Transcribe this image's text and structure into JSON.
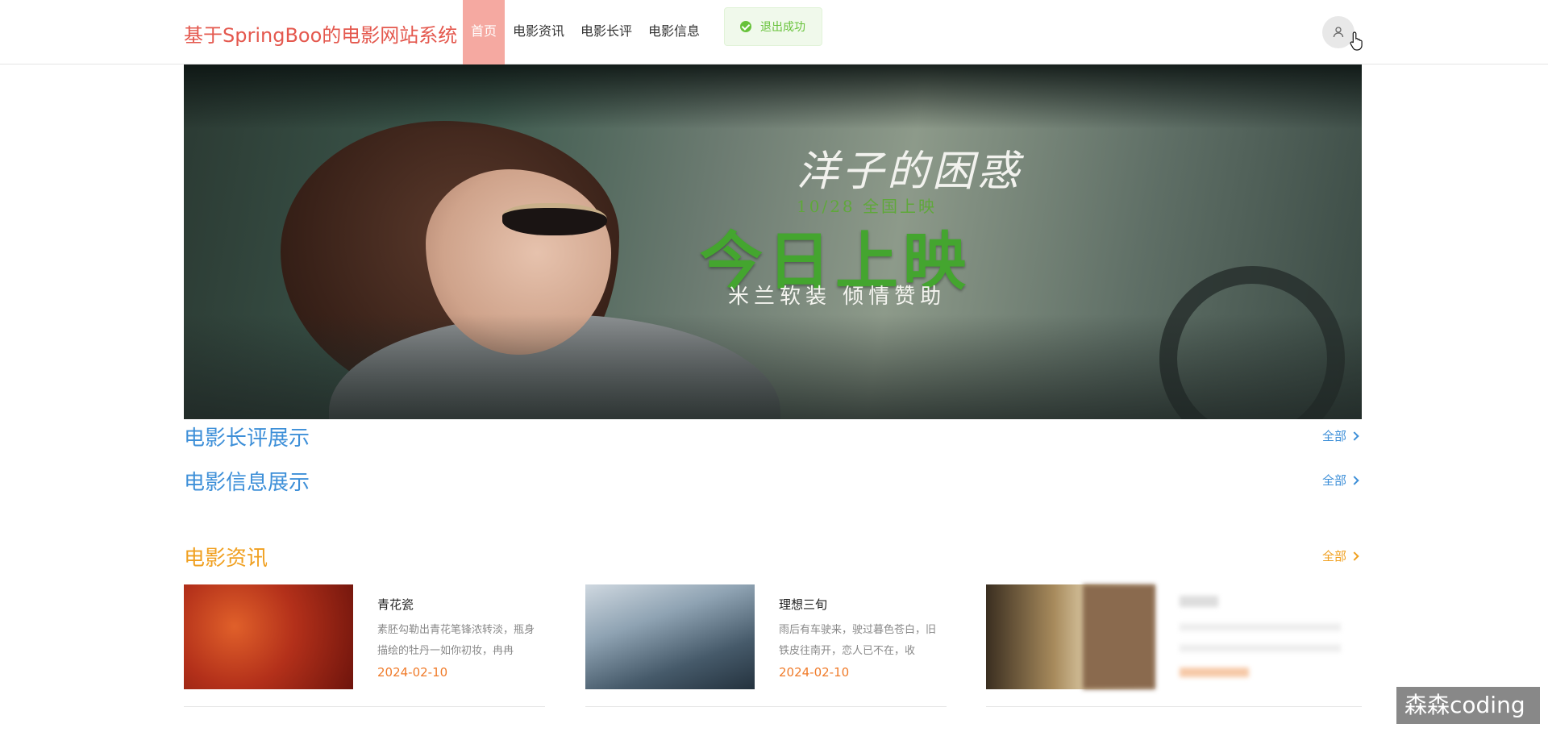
{
  "header": {
    "brand": "基于SpringBoo的电影网站系统",
    "nav": [
      "首页",
      "电影资讯",
      "电影长评",
      "电影信息"
    ],
    "active_nav": "首页"
  },
  "toast": {
    "message": "退出成功"
  },
  "banner": {
    "title": "洋子的困惑",
    "date_line": "10/28 全国上映",
    "headline": "今日上映",
    "sponsor": "米兰软装 倾情赞助"
  },
  "sections": {
    "reviews": {
      "title": "电影长评展示",
      "more": "全部"
    },
    "movies": {
      "title": "电影信息展示",
      "more": "全部"
    },
    "news": {
      "title": "电影资讯",
      "more": "全部"
    }
  },
  "news_items": [
    {
      "title": "青花瓷",
      "summary": "素胚勾勒出青花笔锋浓转淡，瓶身描绘的牡丹一如你初妆，冉冉",
      "date": "2024-02-10"
    },
    {
      "title": "理想三旬",
      "summary": "雨后有车驶来，驶过暮色苍白，旧铁皮往南开，恋人已不在，收",
      "date": "2024-02-10"
    }
  ],
  "watermark": "森森coding",
  "colors": {
    "brand": "#e4584e",
    "nav_active": "#f5a9a1",
    "section_blue": "#3d8fd8",
    "section_orange": "#f0a020",
    "date": "#f07b2a"
  }
}
